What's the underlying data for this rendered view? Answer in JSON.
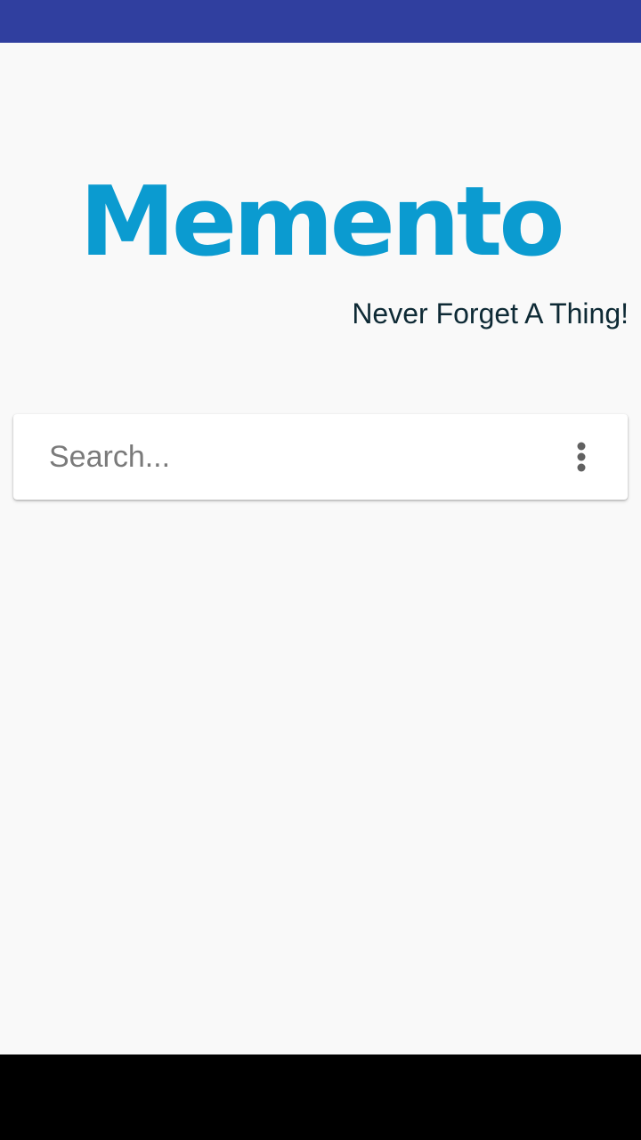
{
  "app": {
    "logo_text": "Memento",
    "tagline": "Never Forget A Thing!"
  },
  "search": {
    "placeholder": "Search...",
    "value": "",
    "menu_icon": "more-vert-icon"
  },
  "colors": {
    "status_bar": "#303f9f",
    "logo": "#0b9bd0",
    "tagline": "#0e2a35",
    "background": "#f9f9f9",
    "nav_bar": "#000000"
  }
}
